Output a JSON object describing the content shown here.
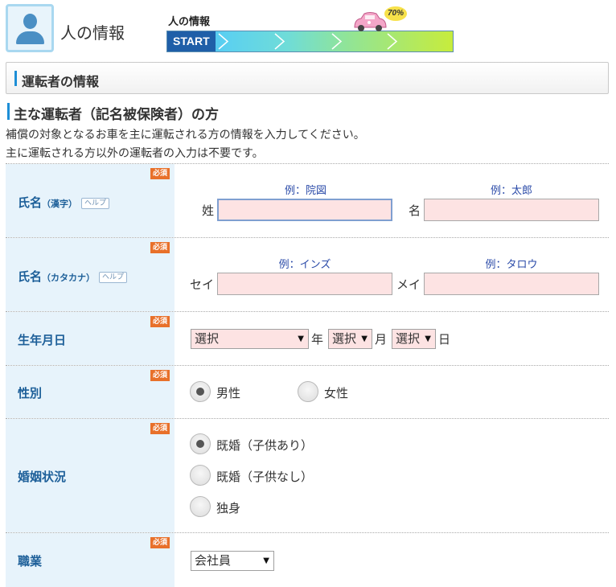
{
  "header": {
    "page_title": "人の情報",
    "progress_label": "人の情報",
    "progress_start": "START",
    "progress_percent": "70%",
    "progress_value": 0.7
  },
  "section": {
    "title": "運転者の情報"
  },
  "subsection": {
    "title": "主な運転者（記名被保険者）の方",
    "desc1": "補償の対象となるお車を主に運転される方の情報を入力してください。",
    "desc2": "主に運転される方以外の運転者の入力は不要です。"
  },
  "rows": {
    "name_kanji": {
      "label": "氏名",
      "sub": "（漢字）",
      "help": "ヘルプ",
      "required": "必須",
      "last_hint": "例：院図",
      "first_hint": "例：太郎",
      "last_label": "姓",
      "first_label": "名",
      "last_value": "",
      "first_value": ""
    },
    "name_kana": {
      "label": "氏名",
      "sub": "（カタカナ）",
      "help": "ヘルプ",
      "required": "必須",
      "last_hint": "例：インズ",
      "first_hint": "例：タロウ",
      "last_label": "セイ",
      "first_label": "メイ",
      "last_value": "",
      "first_value": ""
    },
    "birthdate": {
      "label": "生年月日",
      "required": "必須",
      "year_value": "選択",
      "month_value": "選択",
      "day_value": "選択",
      "year_unit": "年",
      "month_unit": "月",
      "day_unit": "日"
    },
    "gender": {
      "label": "性別",
      "required": "必須",
      "options": [
        "男性",
        "女性"
      ],
      "selected": "男性"
    },
    "marital": {
      "label": "婚姻状況",
      "required": "必須",
      "options": [
        "既婚（子供あり）",
        "既婚（子供なし）",
        "独身"
      ],
      "selected": "既婚（子供あり）"
    },
    "occupation": {
      "label": "職業",
      "required": "必須",
      "value": "会社員"
    }
  },
  "colors": {
    "accent": "#1d8ed6",
    "label_bg": "#e7f3fb",
    "label_text": "#1d5f99",
    "required_badge": "#e8702a",
    "input_bg": "#fde3e3"
  }
}
